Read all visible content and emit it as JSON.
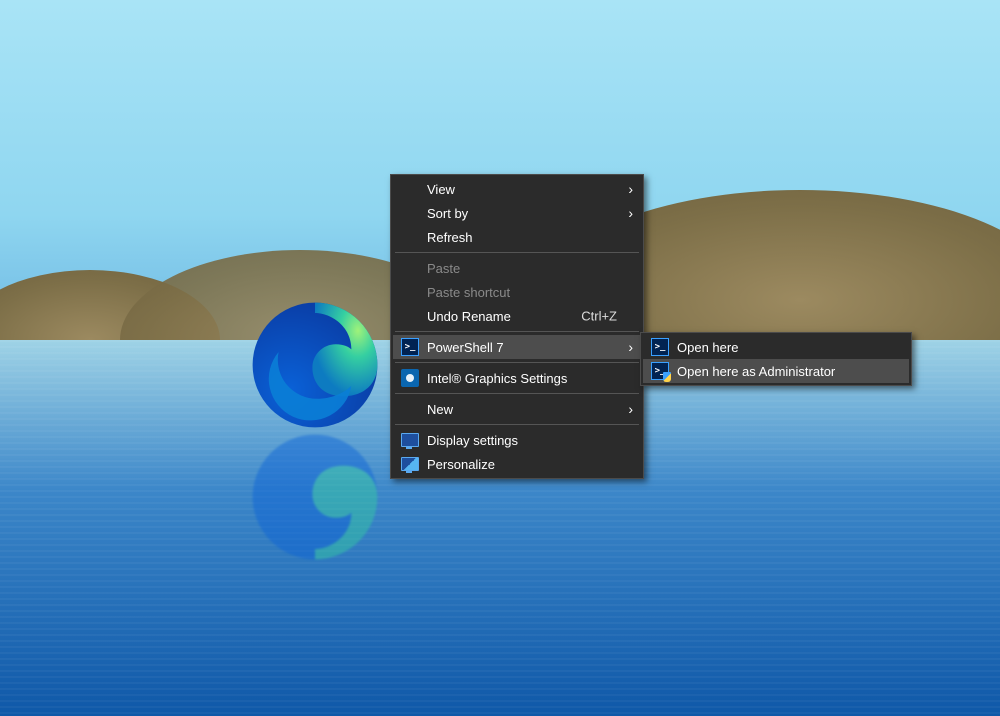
{
  "contextMenu": {
    "view": "View",
    "sortBy": "Sort by",
    "refresh": "Refresh",
    "paste": "Paste",
    "pasteShortcut": "Paste shortcut",
    "undoRename": "Undo Rename",
    "undoHotkey": "Ctrl+Z",
    "powershell": "PowerShell 7",
    "intel": "Intel® Graphics Settings",
    "newItem": "New",
    "displaySettings": "Display settings",
    "personalize": "Personalize"
  },
  "subMenu": {
    "openHere": "Open here",
    "openHereAdmin": "Open here as Administrator"
  }
}
